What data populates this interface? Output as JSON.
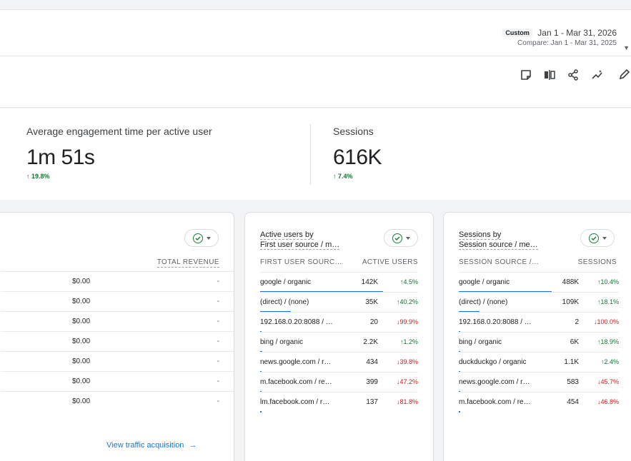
{
  "date_range": {
    "chip": "Custom",
    "range": "Jan 1 - Mar 31, 2026",
    "compare": "Compare: Jan 1 - Mar 31, 2025"
  },
  "kpis": [
    {
      "label": "Average engagement time per active user",
      "value": "1m 51s",
      "change": "19.8%"
    },
    {
      "label": "Sessions",
      "value": "616K",
      "change": "7.4%"
    }
  ],
  "revenue_card": {
    "header": "TOTAL REVENUE",
    "rows": [
      {
        "revenue": "$0.00",
        "change": "-"
      },
      {
        "revenue": "$0.00",
        "change": "-"
      },
      {
        "revenue": "$0.00",
        "change": "-"
      },
      {
        "revenue": "$0.00",
        "change": "-"
      },
      {
        "revenue": "$0.00",
        "change": "-"
      },
      {
        "revenue": "$0.00",
        "change": "-"
      },
      {
        "revenue": "$0.00",
        "change": "-"
      }
    ],
    "link": "View traffic acquisition"
  },
  "users_card": {
    "title_line1": "Active users by",
    "title_line2": "First user source / m…",
    "col1": "FIRST USER SOURC…",
    "col2": "ACTIVE USERS",
    "rows": [
      {
        "name": "google / organic",
        "value": "142K",
        "change": "4.5%",
        "dir": "up",
        "share": 1.0
      },
      {
        "name": "(direct) / (none)",
        "value": "35K",
        "change": "40.2%",
        "dir": "up",
        "share": 0.25
      },
      {
        "name": "192.168.0.20:8088 / …",
        "value": "20",
        "change": "99.9%",
        "dir": "down",
        "share": 0.0
      },
      {
        "name": "bing / organic",
        "value": "2.2K",
        "change": "1.2%",
        "dir": "up",
        "share": 0.016
      },
      {
        "name": "news.google.com / r…",
        "value": "434",
        "change": "39.8%",
        "dir": "down",
        "share": 0.004
      },
      {
        "name": "m.facebook.com / re…",
        "value": "399",
        "change": "47.2%",
        "dir": "down",
        "share": 0.003
      },
      {
        "name": "lm.facebook.com / r…",
        "value": "137",
        "change": "81.8%",
        "dir": "down",
        "share": 0.001
      }
    ]
  },
  "sessions_card": {
    "title_line1": "Sessions by",
    "title_line2": "Session source / me…",
    "col1": "SESSION SOURCE /…",
    "col2": "SESSIONS",
    "rows": [
      {
        "name": "google / organic",
        "value": "488K",
        "change": "10.4%",
        "dir": "up",
        "share": 1.0
      },
      {
        "name": "(direct) / (none)",
        "value": "109K",
        "change": "18.1%",
        "dir": "up",
        "share": 0.22
      },
      {
        "name": "192.168.0.20:8088 / …",
        "value": "2",
        "change": "100.0%",
        "dir": "down",
        "share": 0.0
      },
      {
        "name": "bing / organic",
        "value": "6K",
        "change": "18.9%",
        "dir": "up",
        "share": 0.012
      },
      {
        "name": "duckduckgo / organic",
        "value": "1.1K",
        "change": "2.4%",
        "dir": "up",
        "share": 0.003
      },
      {
        "name": "news.google.com / r…",
        "value": "583",
        "change": "45.7%",
        "dir": "down",
        "share": 0.002
      },
      {
        "name": "m.facebook.com / re…",
        "value": "454",
        "change": "46.8%",
        "dir": "down",
        "share": 0.001
      }
    ]
  },
  "toolbar_icons": [
    "sticky-note-icon",
    "compare-icon",
    "share-icon",
    "insights-icon",
    "edit-icon"
  ],
  "colors": {
    "accent": "#1a73e8",
    "up": "#137333",
    "down": "#c5221f"
  }
}
